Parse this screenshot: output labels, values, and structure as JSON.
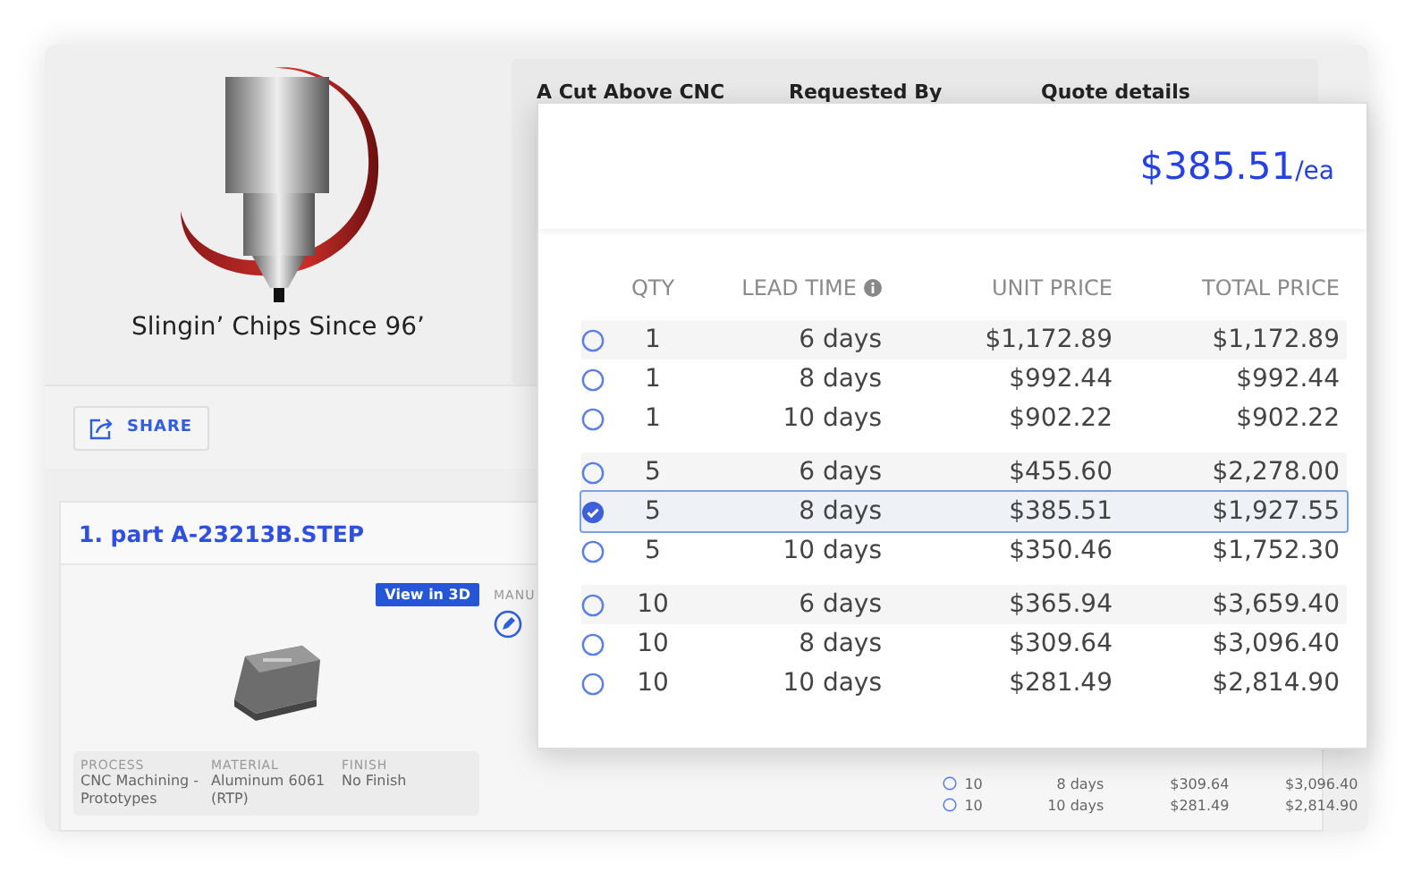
{
  "logo": {
    "tagline": "Slingin’ Chips Since 96’"
  },
  "info_columns": [
    "A Cut Above CNC",
    "Requested By",
    "Quote details"
  ],
  "share_button": {
    "label": "SHARE"
  },
  "part": {
    "title": "1. part A-23213B.STEP",
    "view_button": "View in 3D",
    "column_label": "MANU",
    "specs": [
      {
        "label": "PROCESS",
        "value": "CNC Machining - Prototypes"
      },
      {
        "label": "MATERIAL",
        "value": "Aluminum 6061 (RTP)"
      },
      {
        "label": "FINISH",
        "value": "No Finish"
      }
    ],
    "background_rows": [
      {
        "qty": "10",
        "lead_time": "8 days",
        "unit_price": "$309.64",
        "total_price": "$3,096.40",
        "selected": false
      },
      {
        "qty": "10",
        "lead_time": "10 days",
        "unit_price": "$281.49",
        "total_price": "$2,814.90",
        "selected": false
      }
    ]
  },
  "price_popup": {
    "price": "$385.51",
    "unit": "/ea",
    "columns": [
      "QTY",
      "LEAD TIME",
      "UNIT PRICE",
      "TOTAL PRICE"
    ],
    "groups": [
      {
        "rows": [
          {
            "qty": "1",
            "lead_time": "6 days",
            "unit_price": "$1,172.89",
            "total_price": "$1,172.89",
            "selected": false
          },
          {
            "qty": "1",
            "lead_time": "8 days",
            "unit_price": "$992.44",
            "total_price": "$992.44",
            "selected": false
          },
          {
            "qty": "1",
            "lead_time": "10 days",
            "unit_price": "$902.22",
            "total_price": "$902.22",
            "selected": false
          }
        ]
      },
      {
        "rows": [
          {
            "qty": "5",
            "lead_time": "6 days",
            "unit_price": "$455.60",
            "total_price": "$2,278.00",
            "selected": false
          },
          {
            "qty": "5",
            "lead_time": "8 days",
            "unit_price": "$385.51",
            "total_price": "$1,927.55",
            "selected": true
          },
          {
            "qty": "5",
            "lead_time": "10 days",
            "unit_price": "$350.46",
            "total_price": "$1,752.30",
            "selected": false
          }
        ]
      },
      {
        "rows": [
          {
            "qty": "10",
            "lead_time": "6 days",
            "unit_price": "$365.94",
            "total_price": "$3,659.40",
            "selected": false
          },
          {
            "qty": "10",
            "lead_time": "8 days",
            "unit_price": "$309.64",
            "total_price": "$3,096.40",
            "selected": false
          },
          {
            "qty": "10",
            "lead_time": "10 days",
            "unit_price": "$281.49",
            "total_price": "$2,814.90",
            "selected": false
          }
        ]
      }
    ]
  }
}
